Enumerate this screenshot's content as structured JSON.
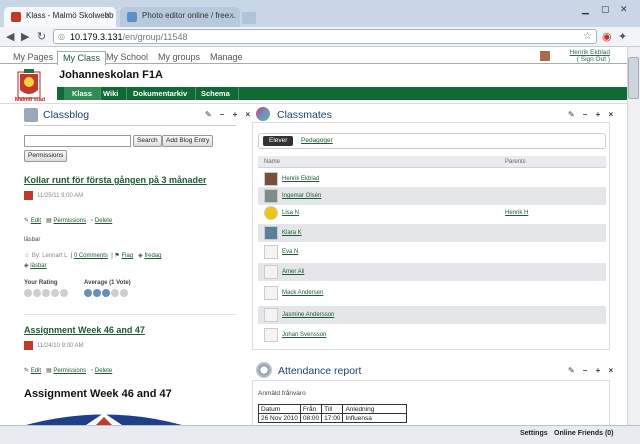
{
  "browser": {
    "tabs": [
      {
        "label": "Klass - Malmö Skolwebb"
      },
      {
        "label": "Photo editor online / free..."
      }
    ],
    "url_host": "10.179.3.131",
    "url_path": "/en/group/11548"
  },
  "site": {
    "menu": [
      "My Pages",
      "My Class",
      "My School",
      "My groups",
      "Manage"
    ],
    "user_name": "Henrik Ekblad",
    "sign_out": "( Sign Out )",
    "logo_text": "Malmö stad",
    "school_title": "Johanneskolan F1A",
    "subnav": [
      "Klass",
      "Wiki",
      "Dokumentarkiv",
      "Schema"
    ]
  },
  "classblog": {
    "title": "Classblog",
    "controls": "✎ – + ×",
    "search_button": "Search",
    "add_button": "Add Blog Entry",
    "permissions_button": "Permissions",
    "post1": {
      "title": "Kollar runt för första gången på 3 månader",
      "date": "11/25/11 9:00 AM",
      "edit": "Edit",
      "permissions": "Permissions",
      "delete": "Delete",
      "tag": "läsbar",
      "author": "By: Lennart L",
      "comments": "0 Comments",
      "flag": "Flag",
      "tag1": "fredag",
      "tag2": "läsbar",
      "your_rating": "Your Rating",
      "average": "Average (1 Vote)",
      "avg_stars": 3
    },
    "post2": {
      "title": "Assignment Week 46 and 47",
      "date": "11/24/10 9:00 AM",
      "edit": "Edit",
      "permissions": "Permissions",
      "delete": "Delete",
      "heading": "Assignment Week 46 and 47"
    }
  },
  "classmates": {
    "title": "Classmates",
    "controls": "✎ – + ×",
    "tab_active": "Elever",
    "tab_other": "Pedagoger",
    "col_name": "Name",
    "col_parents": "Parents",
    "students": [
      {
        "name": "Henrik Ekblad",
        "parent": ""
      },
      {
        "name": "Ingemar Olsén",
        "parent": ""
      },
      {
        "name": "Lisa N",
        "parent": "Henrik H"
      },
      {
        "name": "Klara K",
        "parent": ""
      },
      {
        "name": "Eva N",
        "parent": ""
      },
      {
        "name": "Amer Ali",
        "parent": ""
      },
      {
        "name": "Mack Andersen",
        "parent": ""
      },
      {
        "name": "Jasmine Andersson",
        "parent": ""
      },
      {
        "name": "Johan Svensson",
        "parent": ""
      }
    ]
  },
  "attendance": {
    "title": "Attendance report",
    "controls": "✎ – + ×",
    "subtitle": "Anmäld frånvaro",
    "headers": [
      "Datum",
      "Från",
      "Till",
      "Anledning"
    ],
    "row": [
      "26 Nov 2010",
      "08:00",
      "17:00",
      "Influensa"
    ]
  },
  "statusbar": {
    "settings": "Settings",
    "online": "Online Friends (0)"
  },
  "colors": {
    "brand_green": "#0f6a34",
    "title_blue": "#1c4470"
  }
}
